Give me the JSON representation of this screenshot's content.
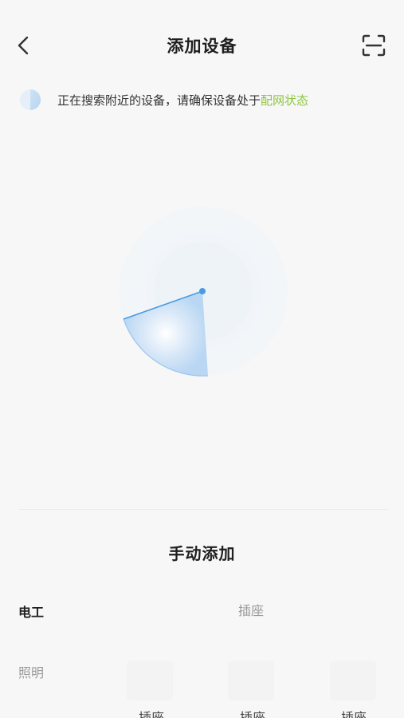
{
  "header": {
    "title": "添加设备",
    "back_icon": "chevron-left-icon",
    "scan_icon": "scan-icon"
  },
  "hint": {
    "text": "正在搜索附近的设备，请确保设备处于",
    "link": "配网状态",
    "link_color": "#8cc63f"
  },
  "manual": {
    "title": "手动添加",
    "categories": [
      {
        "label": "电工",
        "selected": true
      },
      {
        "label": "照明",
        "selected": false
      }
    ],
    "items": [
      {
        "label": "插座"
      },
      {
        "label": "插座"
      },
      {
        "label": "插座"
      },
      {
        "label": "插座"
      }
    ]
  },
  "colors": {
    "accent_blue": "#4a9be3",
    "background": "#f7f7f7"
  }
}
